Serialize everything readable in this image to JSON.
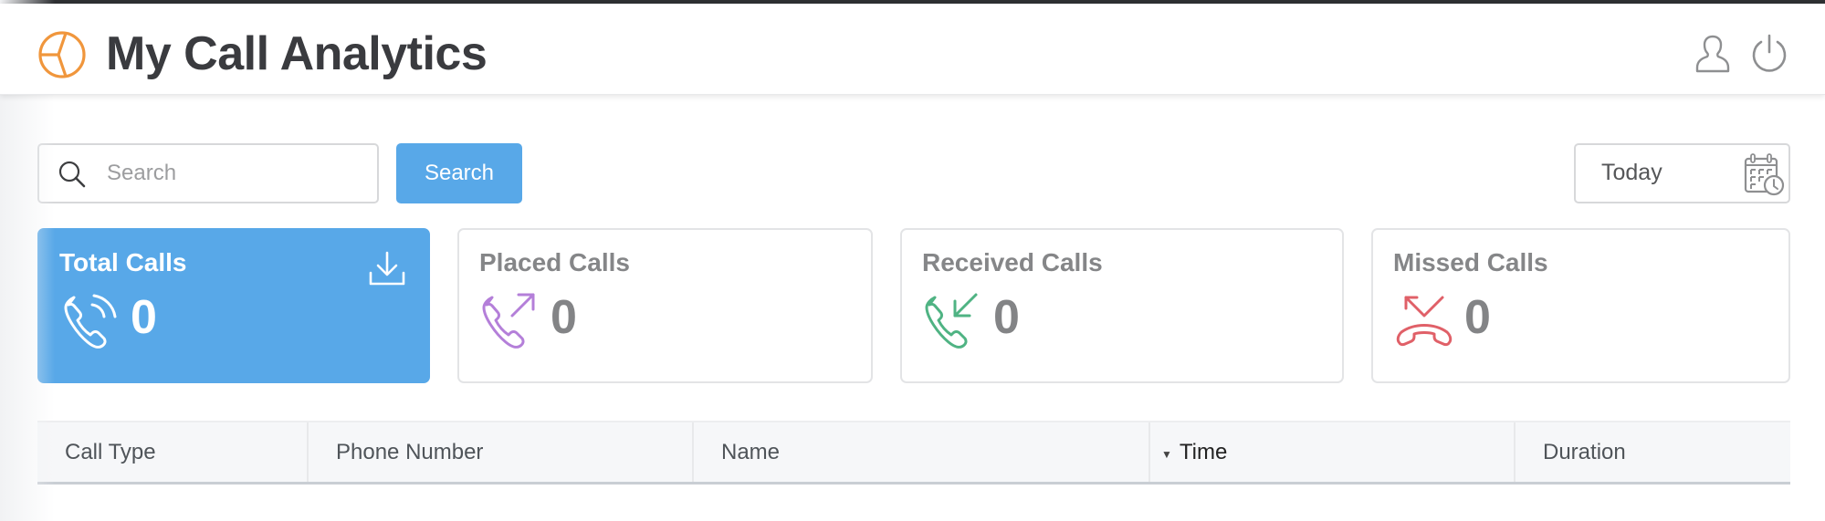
{
  "header": {
    "app_title": "My Call Analytics",
    "logo_icon": "pie-chart-icon",
    "user_icon": "user-icon",
    "power_icon": "power-icon"
  },
  "toolbar": {
    "search_placeholder": "Search",
    "search_value": "",
    "search_button_label": "Search",
    "date_range_label": "Today",
    "date_icon": "calendar-clock-icon"
  },
  "cards": [
    {
      "title": "Total Calls",
      "value": "0",
      "icon": "phone-ringing-icon",
      "active": true,
      "color": "#58a8e8"
    },
    {
      "title": "Placed Calls",
      "value": "0",
      "icon": "phone-outgoing-icon",
      "color": "#b47fd9"
    },
    {
      "title": "Received Calls",
      "value": "0",
      "icon": "phone-incoming-icon",
      "color": "#4fb383"
    },
    {
      "title": "Missed Calls",
      "value": "0",
      "icon": "phone-missed-icon",
      "color": "#e06068"
    }
  ],
  "table": {
    "columns": [
      {
        "label": "Call Type"
      },
      {
        "label": "Phone Number"
      },
      {
        "label": "Name"
      },
      {
        "label": "Time",
        "sorted": "descending"
      },
      {
        "label": "Duration"
      }
    ],
    "rows": []
  },
  "colors": {
    "accent": "#58a8e8",
    "logo": "#f0963c",
    "title_text": "#3a3b3f"
  }
}
